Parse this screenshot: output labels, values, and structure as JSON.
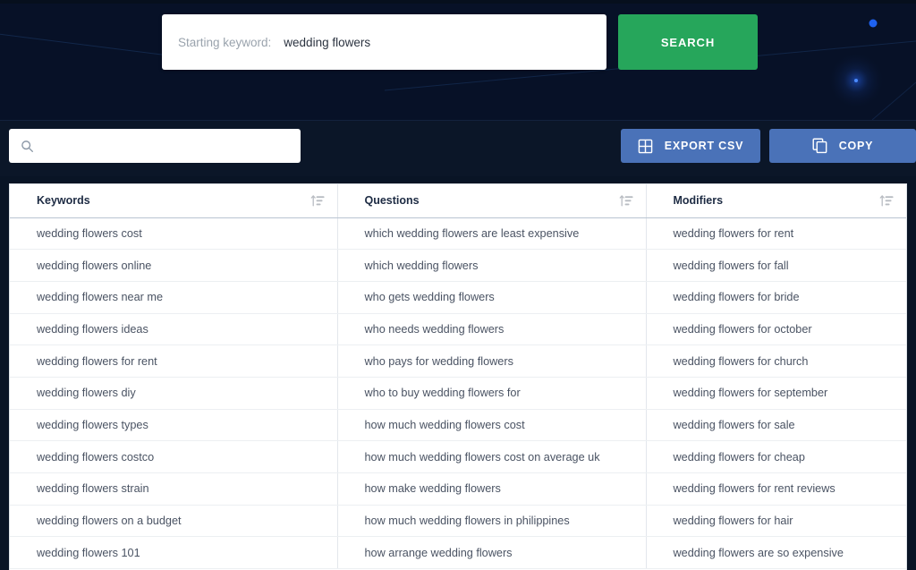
{
  "hero": {
    "keyword_field": {
      "label": "Starting keyword:",
      "value": "wedding flowers"
    },
    "search_button": "SEARCH"
  },
  "toolbar": {
    "filter_placeholder": "",
    "filter_value": "",
    "export_button": "EXPORT CSV",
    "copy_button": "COPY"
  },
  "table": {
    "columns": [
      {
        "label": "Keywords"
      },
      {
        "label": "Questions"
      },
      {
        "label": "Modifiers"
      }
    ],
    "rows": [
      {
        "keyword": "wedding flowers cost",
        "question": "which wedding flowers are least expensive",
        "modifier": "wedding flowers for rent"
      },
      {
        "keyword": "wedding flowers online",
        "question": "which wedding flowers",
        "modifier": "wedding flowers for fall"
      },
      {
        "keyword": "wedding flowers near me",
        "question": "who gets wedding flowers",
        "modifier": "wedding flowers for bride"
      },
      {
        "keyword": "wedding flowers ideas",
        "question": "who needs wedding flowers",
        "modifier": "wedding flowers for october"
      },
      {
        "keyword": "wedding flowers for rent",
        "question": "who pays for wedding flowers",
        "modifier": "wedding flowers for church"
      },
      {
        "keyword": "wedding flowers diy",
        "question": "who to buy wedding flowers for",
        "modifier": "wedding flowers for september"
      },
      {
        "keyword": "wedding flowers types",
        "question": "how much wedding flowers cost",
        "modifier": "wedding flowers for sale"
      },
      {
        "keyword": "wedding flowers costco",
        "question": "how much wedding flowers cost on average uk",
        "modifier": "wedding flowers for cheap"
      },
      {
        "keyword": "wedding flowers strain",
        "question": "how make wedding flowers",
        "modifier": "wedding flowers for rent reviews"
      },
      {
        "keyword": "wedding flowers on a budget",
        "question": "how much wedding flowers in philippines",
        "modifier": "wedding flowers for hair"
      },
      {
        "keyword": "wedding flowers 101",
        "question": "how arrange wedding flowers",
        "modifier": "wedding flowers are so expensive"
      }
    ]
  },
  "icons": {
    "search": "search-icon",
    "sort": "sort-descending-icon",
    "export": "table-grid-icon",
    "copy": "copy-icon"
  },
  "colors": {
    "hero_bg": "#071127",
    "toolbar_bg": "#0b1628",
    "search_green": "#26a65b",
    "button_blue": "#4a72b8",
    "table_bg": "#ffffff",
    "text_dark": "#1d2b43",
    "text_body": "#4a5363",
    "accent_dot": "#1e62f0"
  }
}
